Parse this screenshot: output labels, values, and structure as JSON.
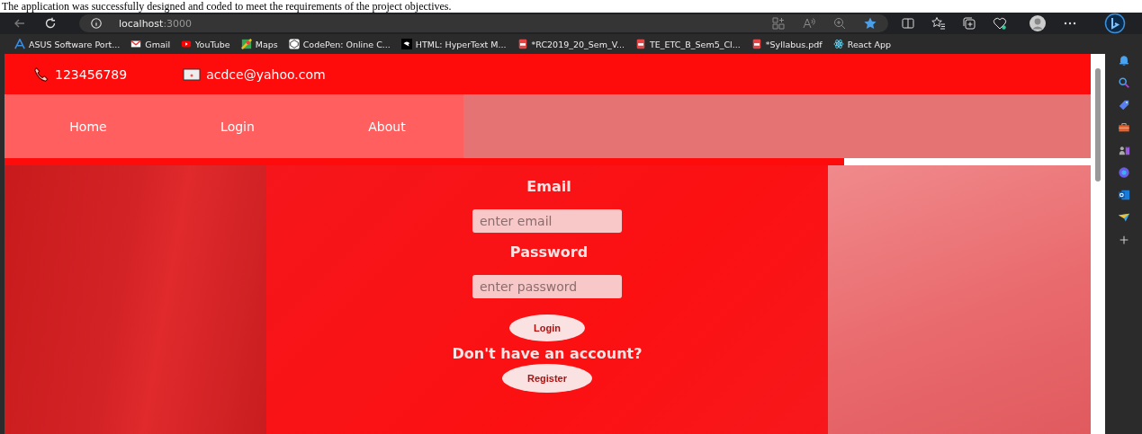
{
  "caption": "The application was successfully designed and coded to meet the requirements of the project objectives.",
  "browser": {
    "address_host": "localhost",
    "address_port": ":3000",
    "bookmarks": [
      "ASUS Software Port...",
      "Gmail",
      "YouTube",
      "Maps",
      "CodePen: Online C...",
      "HTML: HyperText M...",
      "*RC2019_20_Sem_V...",
      "TE_ETC_B_Sem5_Cl...",
      "*Syllabus.pdf",
      "React App"
    ]
  },
  "page": {
    "phone": "123456789",
    "email": "acdce@yahoo.com",
    "nav": [
      "Home",
      "Login",
      "About"
    ],
    "form": {
      "email_label": "Email",
      "email_placeholder": "enter email",
      "password_label": "Password",
      "password_placeholder": "enter password",
      "login_button": "Login",
      "register_prompt": "Don't have an account?",
      "register_button": "Register"
    }
  }
}
